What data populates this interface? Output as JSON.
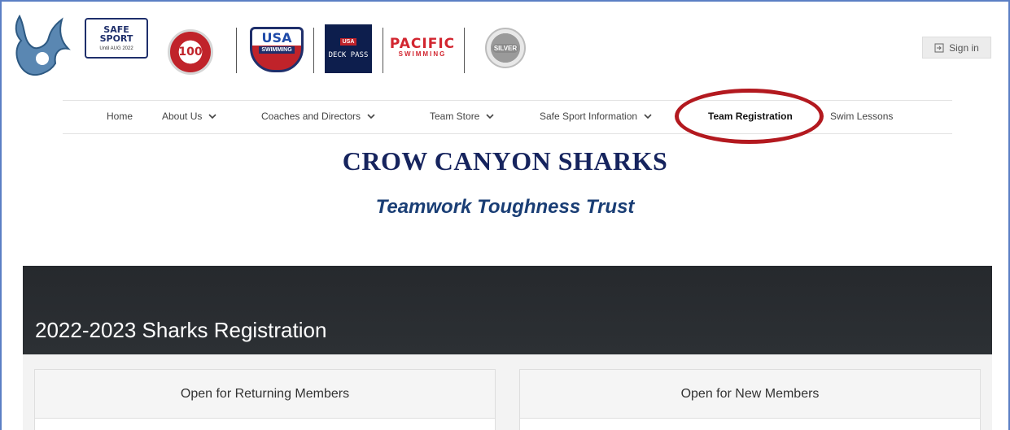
{
  "header": {
    "logos": {
      "club": "shark-fin-logo",
      "safe_sport_line1": "SAFE",
      "safe_sport_line2": "SPORT",
      "safe_sport_sub": "Until AUG 2022",
      "world_100": "100",
      "usa": "USA",
      "usa_swimming": "SWIMMING",
      "deck_usa": "USA",
      "deck_pass": "DECK PASS",
      "pacific": "PACIFIC",
      "pacific_sub": "SWIMMING",
      "silver": "SILVER"
    },
    "sign_in_label": "Sign in"
  },
  "nav": {
    "items": [
      {
        "label": "Home",
        "dropdown": false
      },
      {
        "label": "About Us",
        "dropdown": true
      },
      {
        "label": "Coaches and Directors",
        "dropdown": true
      },
      {
        "label": "Team Store",
        "dropdown": true
      },
      {
        "label": "Safe Sport Information",
        "dropdown": true
      },
      {
        "label": "Team Registration",
        "dropdown": false,
        "active": true
      },
      {
        "label": "Swim Lessons",
        "dropdown": false
      }
    ]
  },
  "hero": {
    "title": "CROW CANYON SHARKS",
    "tagline": "Teamwork Toughness Trust"
  },
  "banner": {
    "title": "2022-2023 Sharks Registration"
  },
  "cards": [
    {
      "header": "Open for Returning Members"
    },
    {
      "header": "Open for New Members"
    }
  ],
  "colors": {
    "title": "#16245e",
    "tagline": "#1a3e75",
    "banner_bg": "#2a2d31",
    "highlight": "#b3191f"
  }
}
